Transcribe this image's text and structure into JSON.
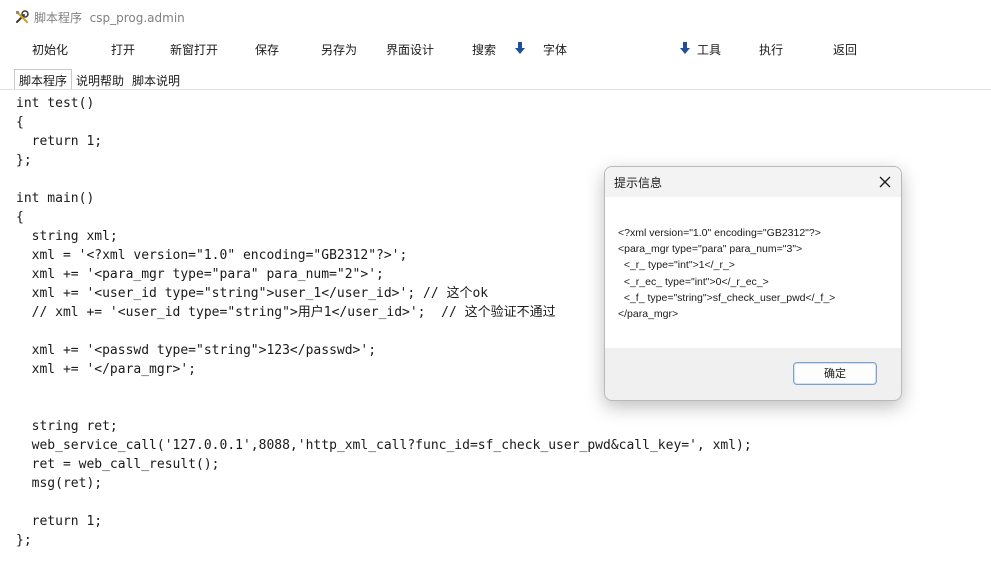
{
  "window": {
    "title": "脚本程序",
    "subtitle": "csp_prog.admin"
  },
  "toolbar": {
    "init": "初始化",
    "open": "打开",
    "open_new_window": "新窗打开",
    "save": "保存",
    "save_as": "另存为",
    "ui_design": "界面设计",
    "search": "搜索",
    "font": "字体",
    "tools": "工具",
    "execute": "执行",
    "back": "返回"
  },
  "tabs": [
    "脚本程序",
    "说明帮助",
    "脚本说明"
  ],
  "editor": {
    "code": "int test()\n{\n  return 1;\n};\n\nint main()\n{\n  string xml;\n  xml = '<?xml version=\"1.0\" encoding=\"GB2312\"?>';\n  xml += '<para_mgr type=\"para\" para_num=\"2\">';\n  xml += '<user_id type=\"string\">user_1</user_id>'; // 这个ok\n  // xml += '<user_id type=\"string\">用户1</user_id>';  // 这个验证不通过\n\n  xml += '<passwd type=\"string\">123</passwd>';\n  xml += '</para_mgr>';\n\n\n  string ret;\n  web_service_call('127.0.0.1',8088,'http_xml_call?func_id=sf_check_user_pwd&call_key=', xml);\n  ret = web_call_result();\n  msg(ret);\n\n  return 1;\n};"
  },
  "dialog": {
    "title": "提示信息",
    "message": "<?xml version=\"1.0\" encoding=\"GB2312\"?>\n<para_mgr type=\"para\" para_num=\"3\">\n  <_r_ type=\"int\">1</_r_>\n  <_r_ec_ type=\"int\">0</_r_ec_>\n  <_f_ type=\"string\">sf_check_user_pwd</_f_>\n</para_mgr>",
    "ok_button": "确定"
  },
  "icons": {
    "app": "tools-icon",
    "dropdown": "down-arrow-icon",
    "close": "close-icon"
  },
  "colors": {
    "arrow": "#1f4e9c",
    "title_text": "#808080"
  }
}
